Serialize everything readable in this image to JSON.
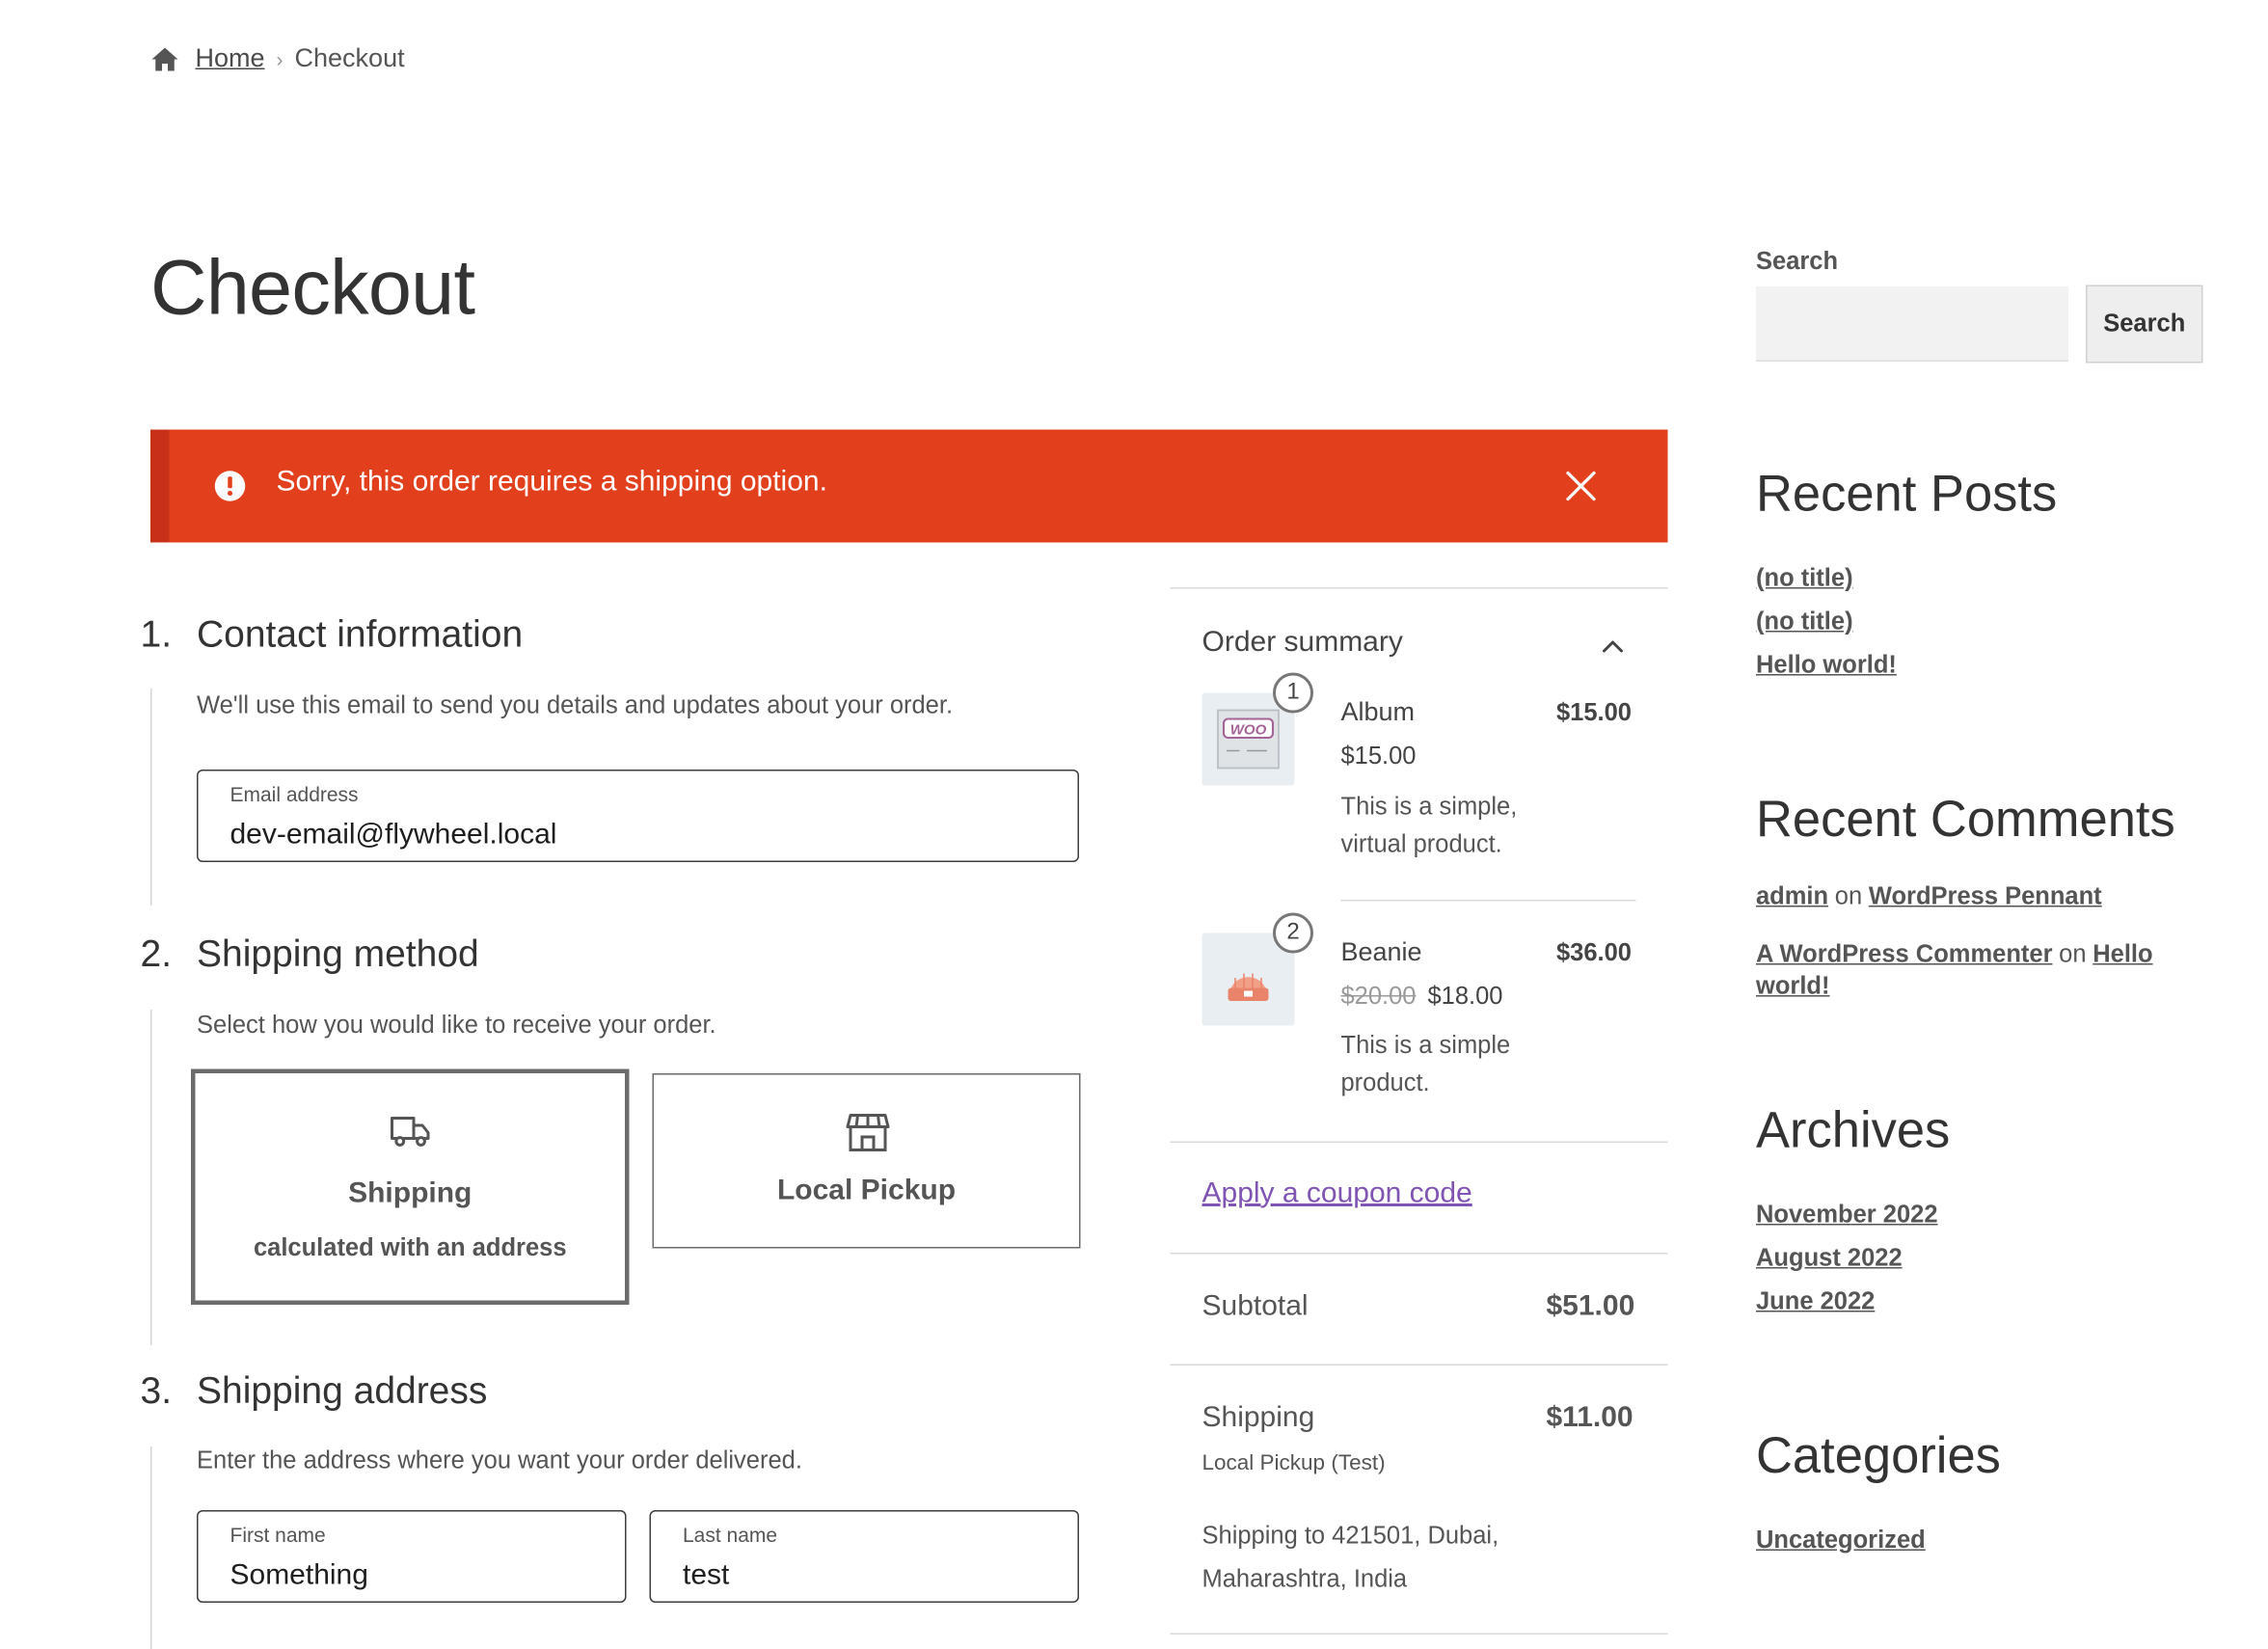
{
  "breadcrumb": {
    "home": "Home",
    "current": "Checkout"
  },
  "page": {
    "title": "Checkout"
  },
  "notice": {
    "message": "Sorry, this order requires a shipping option.",
    "color": "#e2401c"
  },
  "steps": {
    "contact": {
      "number": "1.",
      "title": "Contact information",
      "description": "We'll use this email to send you details and updates about your order.",
      "email_label": "Email address",
      "email_value": "dev-email@flywheel.local"
    },
    "method": {
      "number": "2.",
      "title": "Shipping method",
      "description": "Select how you would like to receive your order.",
      "shipping_title": "Shipping",
      "shipping_sub": "calculated with an address",
      "pickup_title": "Local Pickup",
      "selected": "Shipping"
    },
    "address": {
      "number": "3.",
      "title": "Shipping address",
      "description": "Enter the address where you want your order delivered.",
      "first_label": "First name",
      "first_value": "Something",
      "last_label": "Last name",
      "last_value": "test"
    }
  },
  "summary": {
    "heading": "Order summary",
    "items": [
      {
        "qty": "1",
        "name": "Album",
        "price": "$15.00",
        "description": "This is a simple, virtual product.",
        "total": "$15.00",
        "thumb_label": "WOO"
      },
      {
        "qty": "2",
        "name": "Beanie",
        "regular_price": "$20.00",
        "price": "$18.00",
        "description": "This is a simple product.",
        "total": "$36.00"
      }
    ],
    "coupon": "Apply a coupon code",
    "subtotal_label": "Subtotal",
    "subtotal_value": "$51.00",
    "shipping_label": "Shipping",
    "shipping_value": "$11.00",
    "shipping_method": "Local Pickup (Test)",
    "shipping_to": "Shipping to 421501, Dubai, Maharashtra, India"
  },
  "sidebar": {
    "search_label": "Search",
    "search_button": "Search",
    "search_placeholder": "",
    "recent_posts": {
      "heading": "Recent Posts",
      "items": [
        "(no title)",
        "(no title)",
        "Hello world!"
      ]
    },
    "recent_comments": {
      "heading": "Recent Comments",
      "items": [
        {
          "author": "admin",
          "on": "on",
          "post": "WordPress Pennant"
        },
        {
          "author": "A WordPress Commenter",
          "on": "on",
          "post": "Hello world!"
        }
      ]
    },
    "archives": {
      "heading": "Archives",
      "items": [
        "November 2022",
        "August 2022",
        "June 2022"
      ]
    },
    "categories": {
      "heading": "Categories",
      "items": [
        "Uncategorized"
      ]
    }
  },
  "colors": {
    "link_purple": "#7f54b3",
    "notice_red": "#e2401c"
  }
}
